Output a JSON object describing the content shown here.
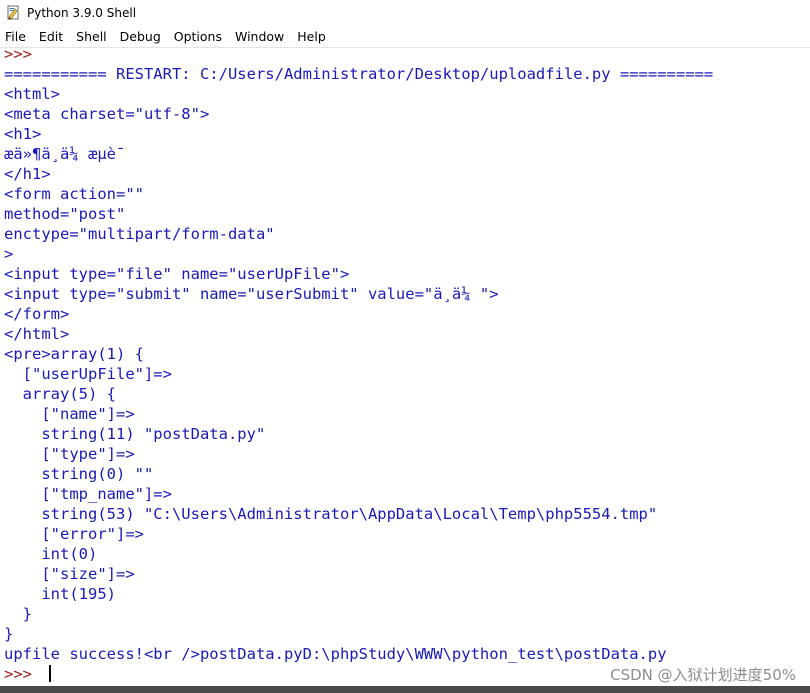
{
  "window": {
    "title": "Python 3.9.0 Shell",
    "icon": "python-idle-icon"
  },
  "menu": [
    {
      "label": "File"
    },
    {
      "label": "Edit"
    },
    {
      "label": "Shell"
    },
    {
      "label": "Debug"
    },
    {
      "label": "Options"
    },
    {
      "label": "Window"
    },
    {
      "label": "Help"
    }
  ],
  "shell": {
    "lines": [
      {
        "text": ">>>",
        "kind": "prompt"
      },
      {
        "text": "=========== RESTART: C:/Users/Administrator/Desktop/uploadfile.py ==========",
        "kind": "out"
      },
      {
        "text": "<html>",
        "kind": "out"
      },
      {
        "text": "<meta charset=\"utf-8\">",
        "kind": "out"
      },
      {
        "text": "<h1>",
        "kind": "out"
      },
      {
        "text": "æä»¶ä¸ä¼ æµè¯",
        "kind": "out"
      },
      {
        "text": "</h1>",
        "kind": "out"
      },
      {
        "text": "<form action=\"\"",
        "kind": "out"
      },
      {
        "text": "method=\"post\"",
        "kind": "out"
      },
      {
        "text": "enctype=\"multipart/form-data\"",
        "kind": "out"
      },
      {
        "text": ">",
        "kind": "out"
      },
      {
        "text": "<input type=\"file\" name=\"userUpFile\">",
        "kind": "out"
      },
      {
        "text": "<input type=\"submit\" name=\"userSubmit\" value=\"ä¸ä¼ \">",
        "kind": "out"
      },
      {
        "text": "</form>",
        "kind": "out"
      },
      {
        "text": "</html>",
        "kind": "out"
      },
      {
        "text": "<pre>array(1) {",
        "kind": "out"
      },
      {
        "text": "  [\"userUpFile\"]=>",
        "kind": "out"
      },
      {
        "text": "  array(5) {",
        "kind": "out"
      },
      {
        "text": "    [\"name\"]=>",
        "kind": "out"
      },
      {
        "text": "    string(11) \"postData.py\"",
        "kind": "out"
      },
      {
        "text": "    [\"type\"]=>",
        "kind": "out"
      },
      {
        "text": "    string(0) \"\"",
        "kind": "out"
      },
      {
        "text": "    [\"tmp_name\"]=>",
        "kind": "out"
      },
      {
        "text": "    string(53) \"C:\\Users\\Administrator\\AppData\\Local\\Temp\\php5554.tmp\"",
        "kind": "out"
      },
      {
        "text": "    [\"error\"]=>",
        "kind": "out"
      },
      {
        "text": "    int(0)",
        "kind": "out"
      },
      {
        "text": "    [\"size\"]=>",
        "kind": "out"
      },
      {
        "text": "    int(195)",
        "kind": "out"
      },
      {
        "text": "  }",
        "kind": "out"
      },
      {
        "text": "}",
        "kind": "out"
      },
      {
        "text": "upfile success!<br />postData.pyD:\\phpStudy\\WWW\\python_test\\postData.py",
        "kind": "out"
      },
      {
        "text": ">>> ",
        "kind": "prompt",
        "cursor": true
      }
    ]
  },
  "watermark": "CSDN @入狱计划进度50%",
  "colors": {
    "prompt": "#9b1e14",
    "output": "#1a1ab8",
    "background": "#ffffff"
  }
}
